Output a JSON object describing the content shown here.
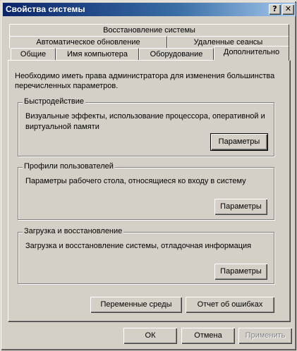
{
  "window": {
    "title": "Свойства системы",
    "help_label": "?",
    "close_label": "✕"
  },
  "tabs": {
    "row1": [
      "Восстановление системы"
    ],
    "row2": [
      "Автоматическое обновление",
      "Удаленные сеансы"
    ],
    "row3": [
      "Общие",
      "Имя компьютера",
      "Оборудование",
      "Дополнительно"
    ],
    "active": "Дополнительно"
  },
  "panel": {
    "intro": "Необходимо иметь права администратора для изменения большинства перечисленных параметров.",
    "performance": {
      "title": "Быстродействие",
      "description": "Визуальные эффекты, использование процессора, оперативной и виртуальной памяти",
      "button": "Параметры"
    },
    "profiles": {
      "title": "Профили пользователей",
      "description": "Параметры рабочего стола, относящиеся ко входу в систему",
      "button": "Параметры"
    },
    "startup": {
      "title": "Загрузка и восстановление",
      "description": "Загрузка и восстановление системы, отладочная информация",
      "button": "Параметры"
    },
    "env_button": "Переменные среды",
    "error_button": "Отчет об ошибках"
  },
  "footer": {
    "ok": "ОК",
    "cancel": "Отмена",
    "apply": "Применить"
  }
}
